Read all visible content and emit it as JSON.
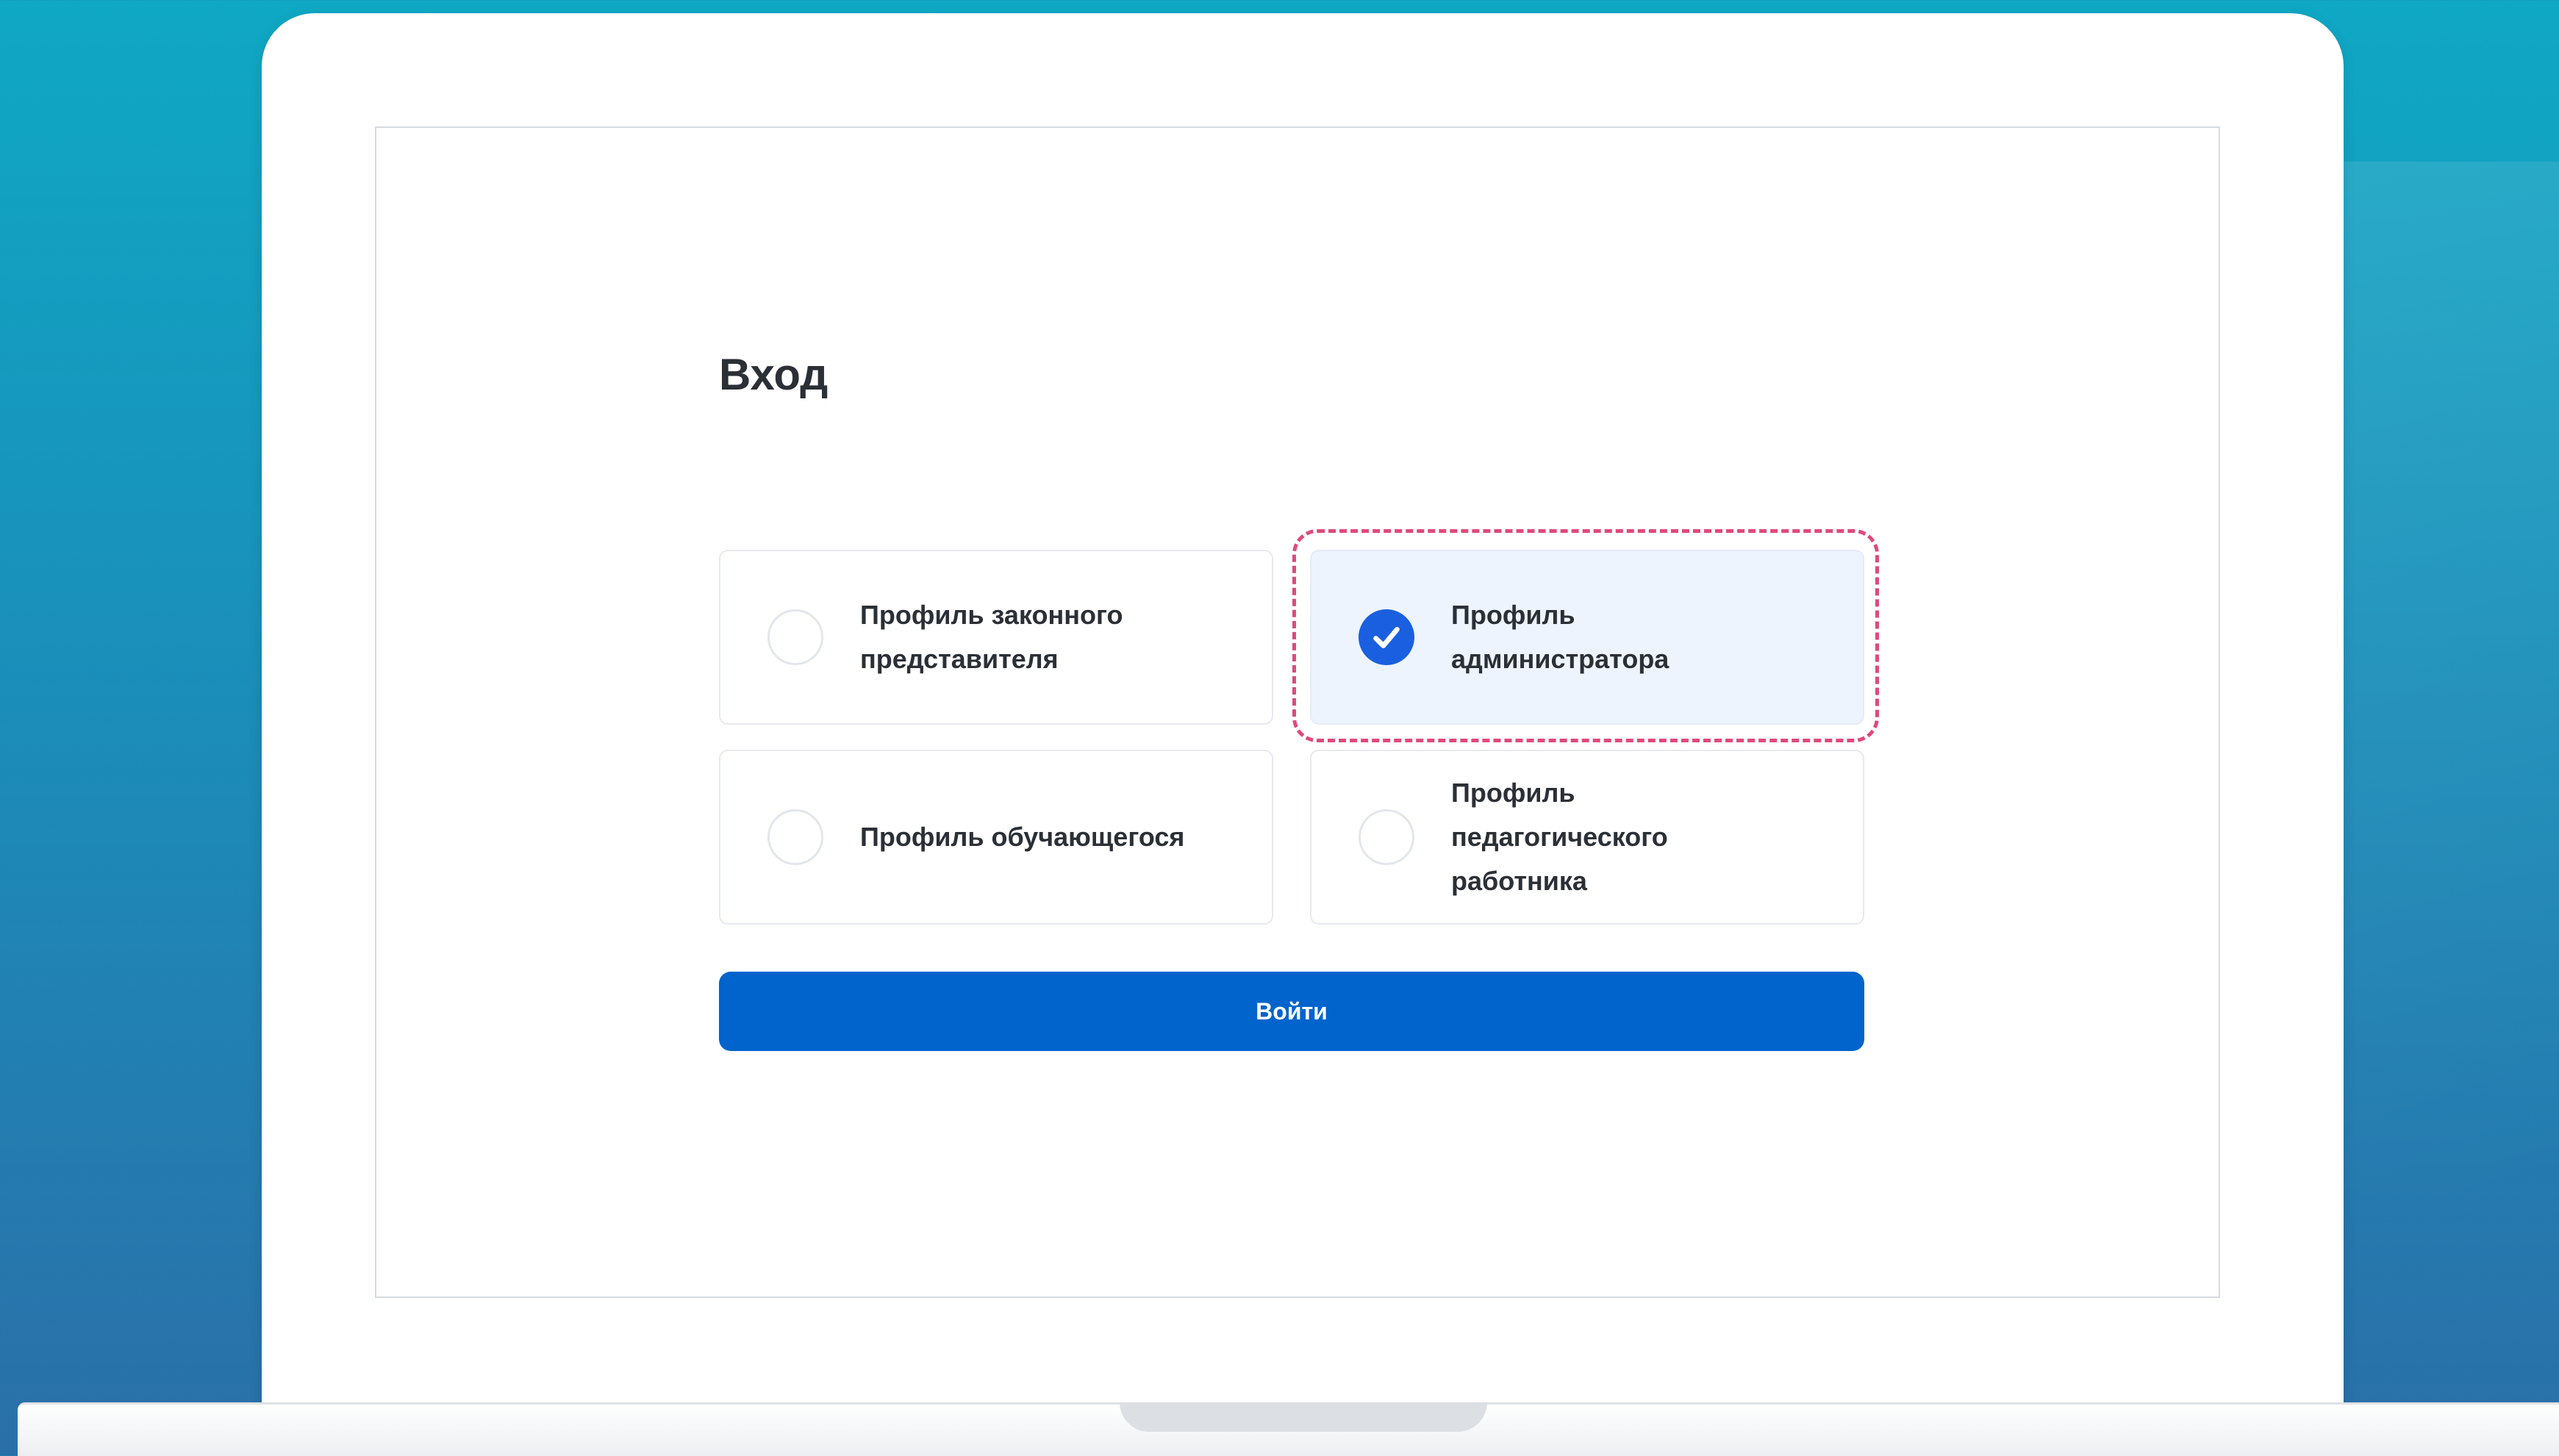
{
  "login": {
    "title": "Вход",
    "profiles": [
      {
        "label": "Профиль законного представителя",
        "selected": false
      },
      {
        "label": "Профиль администратора",
        "selected": true
      },
      {
        "label": "Профиль обучающегося",
        "selected": false
      },
      {
        "label": "Профиль педагогического работника",
        "selected": false
      }
    ],
    "submit_label": "Войти"
  },
  "icons": {
    "checked": "check-circle-icon",
    "unchecked": "empty-circle-icon"
  },
  "colors": {
    "accent": "#0064cc",
    "check": "#1a5fe0",
    "selected_card_bg": "#eef4fd",
    "highlight_outline": "#e0497c"
  }
}
